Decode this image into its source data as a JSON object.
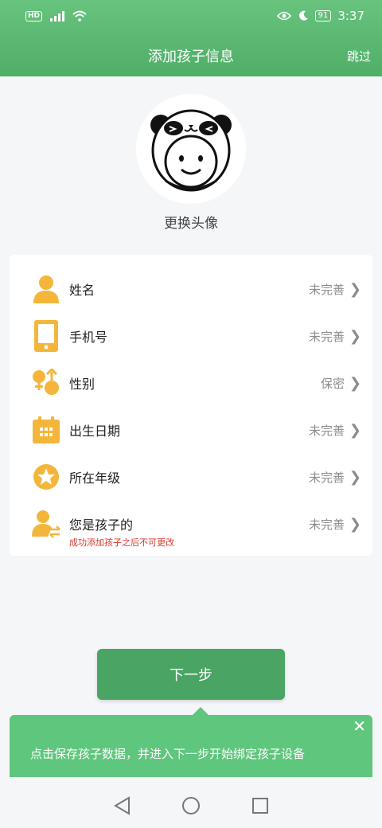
{
  "status": {
    "left": "HD 4G",
    "battery": "91",
    "time": "3:37"
  },
  "header": {
    "title": "添加孩子信息",
    "skip_label": "跳过"
  },
  "avatar": {
    "change_label": "更换头像"
  },
  "form": {
    "rows": [
      {
        "icon": "person-icon",
        "label": "姓名",
        "value": "未完善"
      },
      {
        "icon": "phone-icon",
        "label": "手机号",
        "value": "未完善"
      },
      {
        "icon": "gender-icon",
        "label": "性别",
        "value": "保密"
      },
      {
        "icon": "calendar-icon",
        "label": "出生日期",
        "value": "未完善"
      },
      {
        "icon": "star-icon",
        "label": "所在年级",
        "value": "未完善"
      },
      {
        "icon": "relation-icon",
        "label": "您是孩子的",
        "value": "未完善",
        "note": "成功添加孩子之后不可更改"
      }
    ]
  },
  "next_button": {
    "label": "下一步"
  },
  "tooltip": {
    "text": "点击保存孩子数据，并进入下一步开始绑定孩子设备"
  },
  "colors": {
    "header_green": "#5bb873",
    "button_green": "#4aa564",
    "icon_yellow": "#f3b63a",
    "note_red": "#d9382c"
  }
}
